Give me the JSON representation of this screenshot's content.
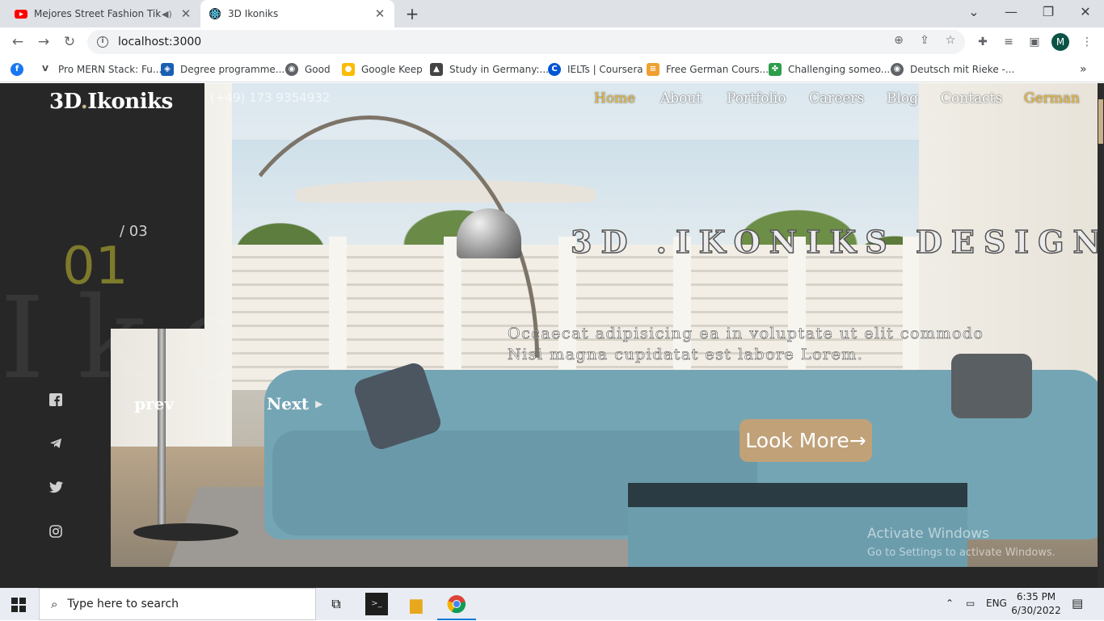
{
  "browser": {
    "tabs": [
      {
        "title": "Mejores Street Fashion Tik To",
        "active": false
      },
      {
        "title": "3D Ikoniks",
        "active": true
      }
    ],
    "url": "localhost:3000",
    "profile_initial": "M",
    "bookmarks": [
      "Pro MERN Stack: Fu...",
      "Degree programme...",
      "Good",
      "Google Keep",
      "Study in Germany:...",
      "IELTs | Coursera",
      "Free German Cours...",
      "Challenging someo...",
      "Deutsch mit Rieke -..."
    ]
  },
  "site": {
    "brand_main": "3D",
    "brand_dot": ".",
    "brand_rest": "Ikoniks",
    "phone": "(+49) 173 9354932",
    "nav": [
      "Home",
      "About",
      "Portfolio",
      "Careers",
      "Blog",
      "Contacts",
      "German"
    ],
    "active_nav": "Home",
    "slide_total": "/ 03",
    "slide_current": "01",
    "ghost_text": "Iko",
    "prev": "prev",
    "next": "Next",
    "headline": "3D .IKONIKS DESIGN",
    "subline_1": "Occaecat adipisicing ea in voluptate ut elit commodo",
    "subline_2": "Nisi magna cupidatat est labore Lorem.",
    "cta": "Look More→",
    "accent_color": "#e8b83a",
    "cta_color": "#c0a178"
  },
  "os": {
    "activate_title": "Activate Windows",
    "activate_sub": "Go to Settings to activate Windows.",
    "search_placeholder": "Type here to search",
    "lang": "ENG",
    "time": "6:35 PM",
    "date": "6/30/2022"
  }
}
